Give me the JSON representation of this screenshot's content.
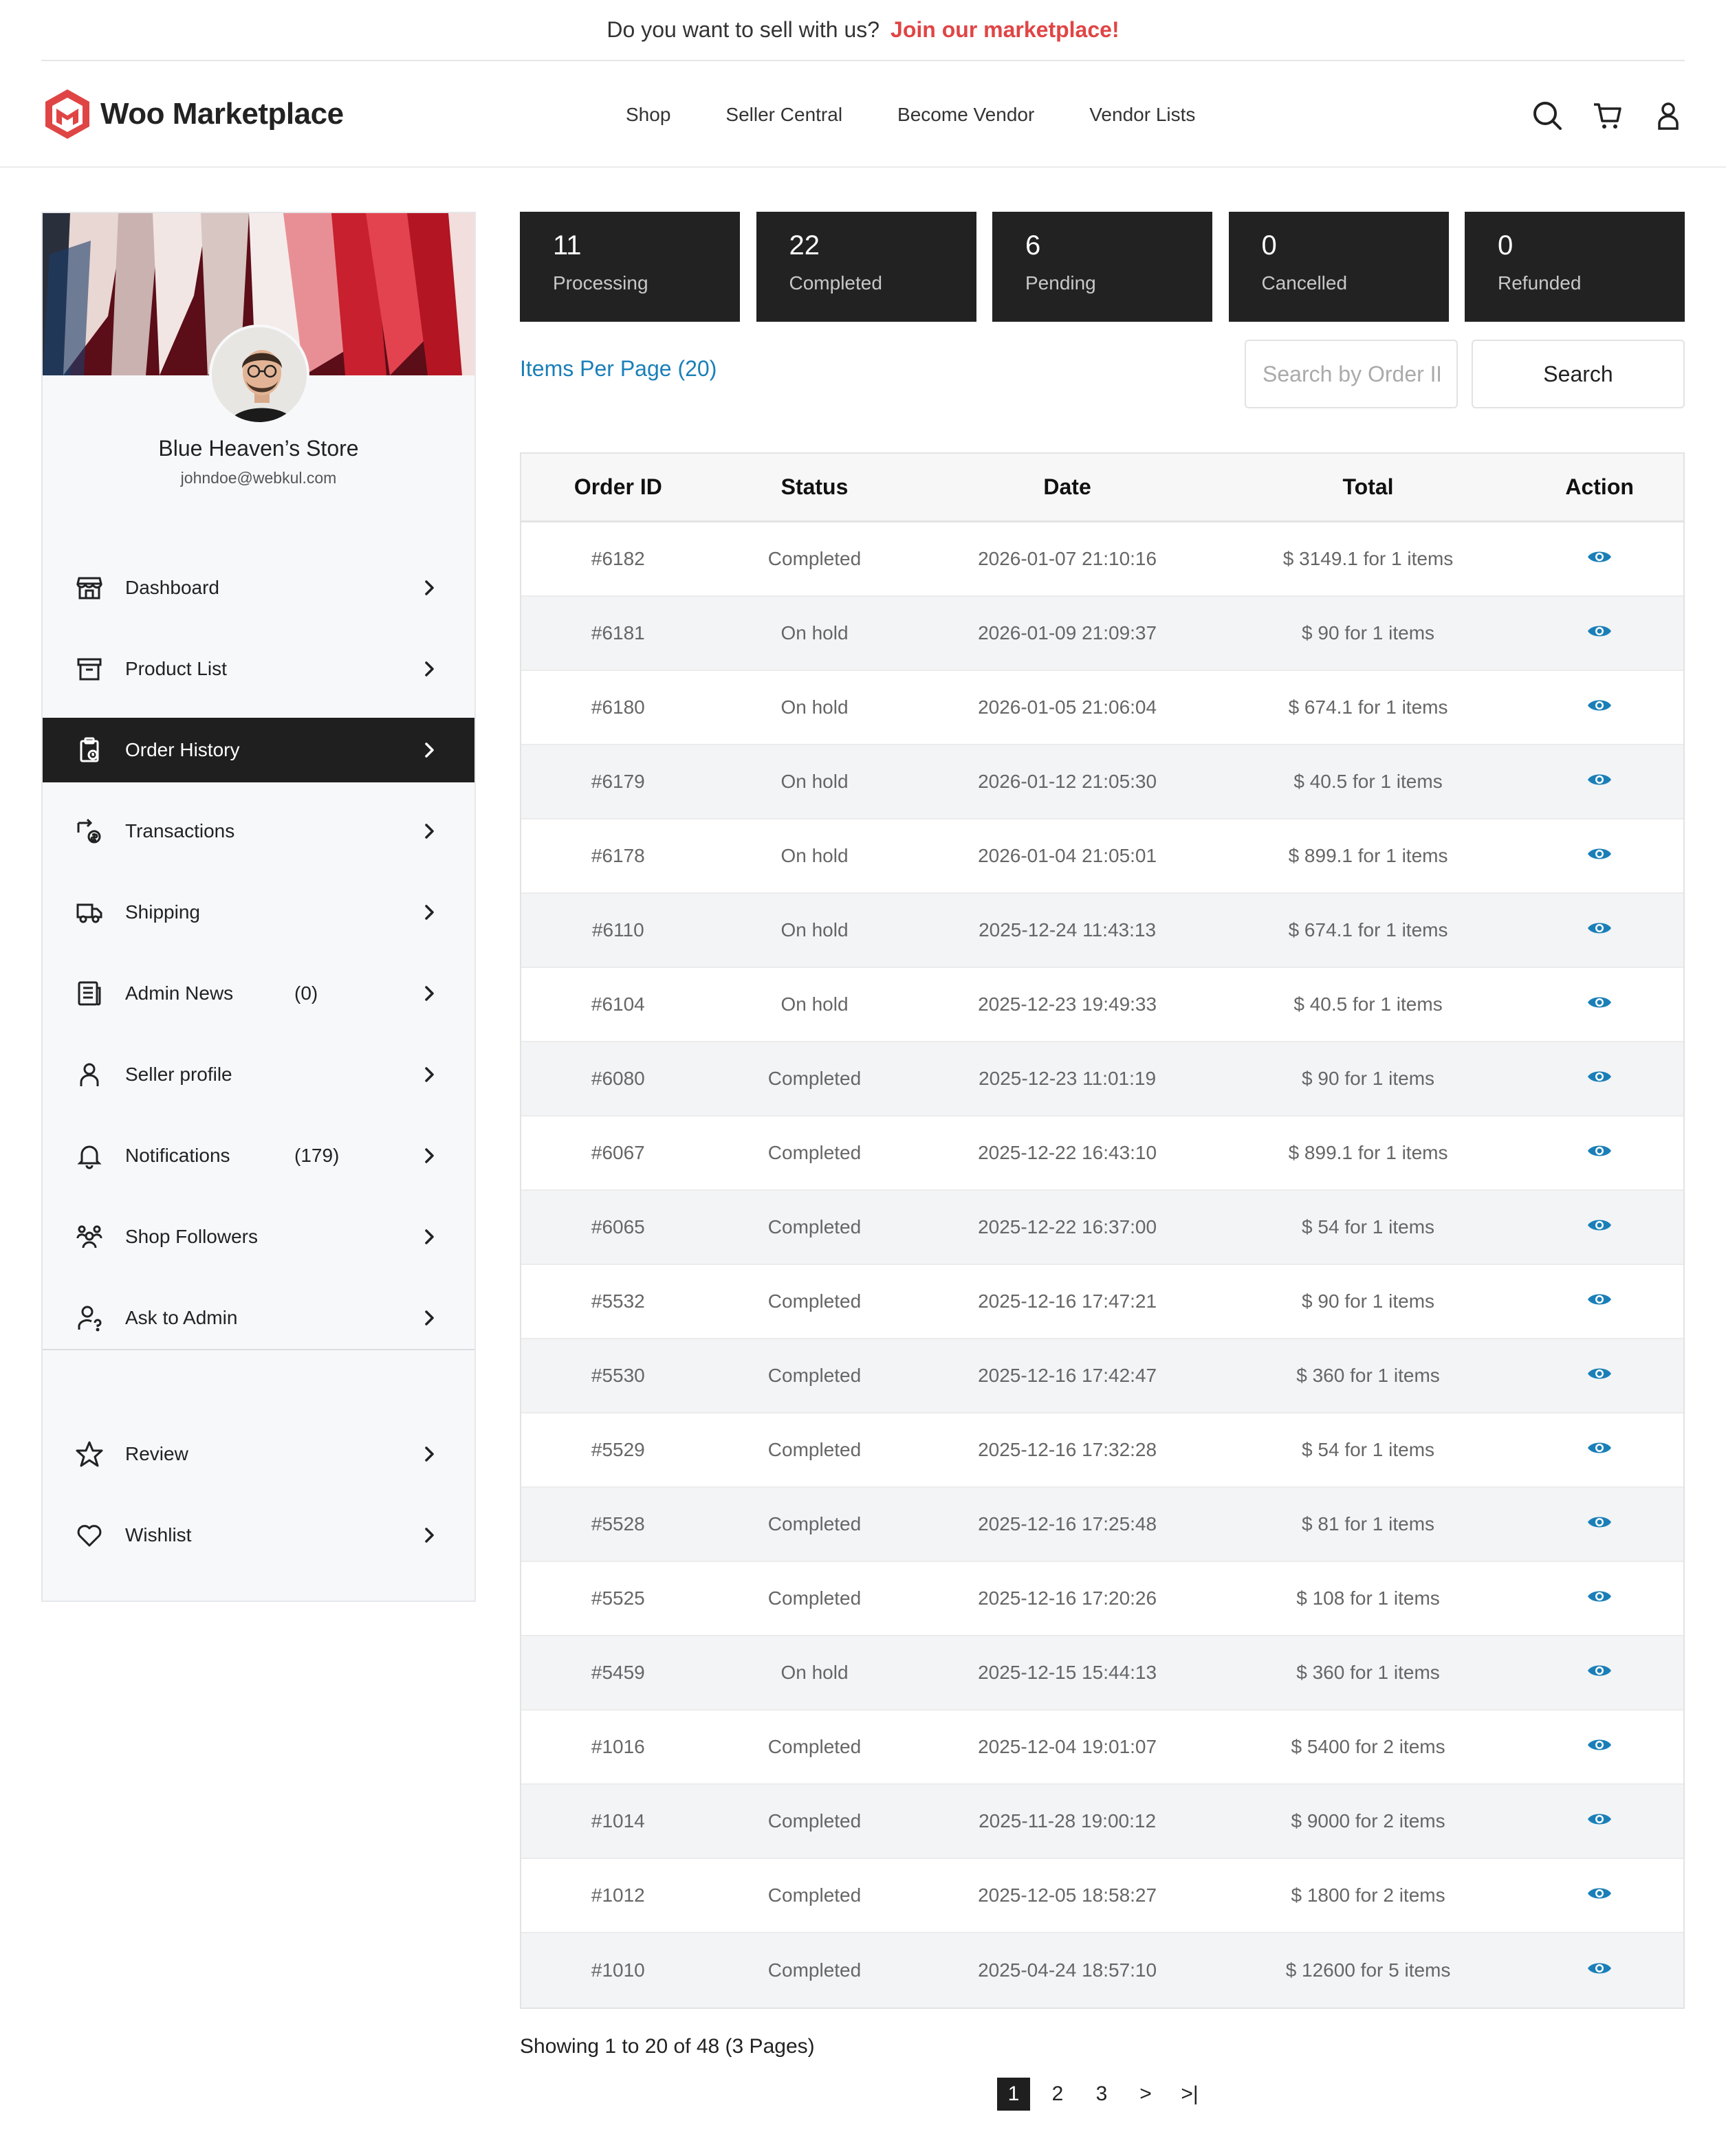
{
  "promo": {
    "text": "Do you want to sell with us?",
    "link": "Join our marketplace!"
  },
  "brand": {
    "name": "Woo Marketplace",
    "accent": "#e04545"
  },
  "nav": [
    "Shop",
    "Seller Central",
    "Become Vendor",
    "Vendor Lists"
  ],
  "header_icons": [
    "search-icon",
    "cart-icon",
    "user-icon"
  ],
  "profile": {
    "store_name": "Blue Heaven’s Store",
    "email": "johndoe@webkul.com"
  },
  "menu": [
    {
      "label": "Dashboard",
      "icon": "store-icon",
      "count": ""
    },
    {
      "label": "Product List",
      "icon": "archive-icon",
      "count": ""
    },
    {
      "label": "Order History",
      "icon": "clipboard-icon",
      "count": "",
      "active": true
    },
    {
      "label": "Transactions",
      "icon": "transaction-icon",
      "count": ""
    },
    {
      "label": "Shipping",
      "icon": "truck-icon",
      "count": ""
    },
    {
      "label": "Admin News",
      "icon": "news-icon",
      "count": "(0)"
    },
    {
      "label": "Seller profile",
      "icon": "person-icon",
      "count": ""
    },
    {
      "label": "Notifications",
      "icon": "bell-icon",
      "count": "(179)"
    },
    {
      "label": "Shop Followers",
      "icon": "followers-icon",
      "count": ""
    },
    {
      "label": "Ask to Admin",
      "icon": "ask-icon",
      "count": ""
    }
  ],
  "menu_secondary": [
    {
      "label": "Review",
      "icon": "star-icon"
    },
    {
      "label": "Wishlist",
      "icon": "heart-icon"
    }
  ],
  "stats": [
    {
      "value": "11",
      "label": "Processing"
    },
    {
      "value": "22",
      "label": "Completed"
    },
    {
      "value": "6",
      "label": "Pending"
    },
    {
      "value": "0",
      "label": "Cancelled"
    },
    {
      "value": "0",
      "label": "Refunded"
    }
  ],
  "controls": {
    "items_per_page": "Items Per Page (20)",
    "search_placeholder": "Search by Order ID",
    "search_button": "Search"
  },
  "table": {
    "headers": [
      "Order ID",
      "Status",
      "Date",
      "Total",
      "Action"
    ],
    "rows": [
      [
        "#6182",
        "Completed",
        "2026-01-07 21:10:16",
        "$ 3149.1 for 1 items"
      ],
      [
        "#6181",
        "On hold",
        "2026-01-09 21:09:37",
        "$ 90 for 1 items"
      ],
      [
        "#6180",
        "On hold",
        "2026-01-05 21:06:04",
        "$ 674.1 for 1 items"
      ],
      [
        "#6179",
        "On hold",
        "2026-01-12 21:05:30",
        "$ 40.5 for 1 items"
      ],
      [
        "#6178",
        "On hold",
        "2026-01-04 21:05:01",
        "$ 899.1 for 1 items"
      ],
      [
        "#6110",
        "On hold",
        "2025-12-24 11:43:13",
        "$ 674.1 for 1 items"
      ],
      [
        "#6104",
        "On hold",
        "2025-12-23 19:49:33",
        "$ 40.5 for 1 items"
      ],
      [
        "#6080",
        "Completed",
        "2025-12-23 11:01:19",
        "$ 90 for 1 items"
      ],
      [
        "#6067",
        "Completed",
        "2025-12-22 16:43:10",
        "$ 899.1 for 1 items"
      ],
      [
        "#6065",
        "Completed",
        "2025-12-22 16:37:00",
        "$ 54 for 1 items"
      ],
      [
        "#5532",
        "Completed",
        "2025-12-16 17:47:21",
        "$ 90 for 1 items"
      ],
      [
        "#5530",
        "Completed",
        "2025-12-16 17:42:47",
        "$ 360 for 1 items"
      ],
      [
        "#5529",
        "Completed",
        "2025-12-16 17:32:28",
        "$ 54 for 1 items"
      ],
      [
        "#5528",
        "Completed",
        "2025-12-16 17:25:48",
        "$ 81 for 1 items"
      ],
      [
        "#5525",
        "Completed",
        "2025-12-16 17:20:26",
        "$ 108 for 1 items"
      ],
      [
        "#5459",
        "On hold",
        "2025-12-15 15:44:13",
        "$ 360 for 1 items"
      ],
      [
        "#1016",
        "Completed",
        "2025-12-04 19:01:07",
        "$ 5400 for 2 items"
      ],
      [
        "#1014",
        "Completed",
        "2025-11-28 19:00:12",
        "$ 9000 for 2 items"
      ],
      [
        "#1012",
        "Completed",
        "2025-12-05 18:58:27",
        "$ 1800 for 2 items"
      ],
      [
        "#1010",
        "Completed",
        "2025-04-24 18:57:10",
        "$ 12600 for 5 items"
      ]
    ],
    "action_icon": "eye-icon",
    "action_color": "#1a7fb8"
  },
  "footer": {
    "showing": "Showing 1 to 20 of 48 (3 Pages)",
    "pages": [
      "1",
      "2",
      "3",
      ">",
      ">|"
    ],
    "current_page": "1"
  }
}
